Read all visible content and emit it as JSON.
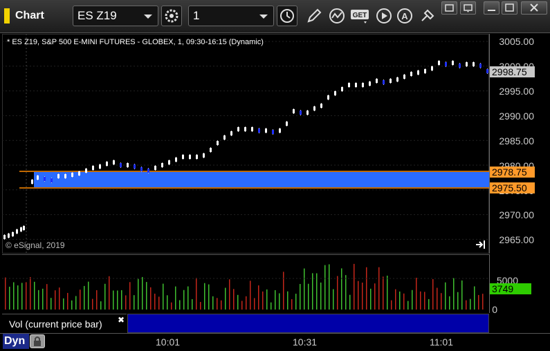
{
  "window": {
    "title": "Chart",
    "symbol": "ES Z19",
    "interval": "1",
    "buttons": [
      "pin-icon",
      "restore-down-icon",
      "minimize-icon",
      "maximize-icon",
      "close-icon"
    ]
  },
  "toolbar": {
    "tools": [
      "settings-icon",
      "clock-icon",
      "pencil-icon",
      "study-icon",
      "get-icon",
      "play-icon",
      "a-icon",
      "arrow-tool-icon"
    ]
  },
  "chart": {
    "header": "* ES Z19, S&P 500 E-MINI FUTURES - GLOBEX, 1, 09:30-16:15 (Dynamic)",
    "copyright": "© eSignal, 2019",
    "price_ticks": [
      "3005.00",
      "3000.00",
      "2995.00",
      "2990.00",
      "2985.00",
      "2980.00",
      "2975.00",
      "2970.00",
      "2965.00"
    ],
    "current_price_tag": "2998.75",
    "upper_line_tag": "2978.75",
    "lower_line_tag": "2975.50",
    "colors": {
      "up_bar": "#ffffff",
      "down_bar": "#1e2fff",
      "zone": "#2a6bff",
      "lines": "#ff8a00",
      "price_tag": "#c8c8c8",
      "line_tag": "#ff9a2a"
    }
  },
  "volume": {
    "legend": "Vol (current price bar)",
    "ticks": [
      "5000",
      "0"
    ],
    "current_tag": "3749",
    "tag_color": "#2ecc00"
  },
  "time_axis": {
    "labels": [
      "10:01",
      "10:31",
      "11:01"
    ]
  },
  "footer": {
    "dyn_label": "Dyn"
  }
}
